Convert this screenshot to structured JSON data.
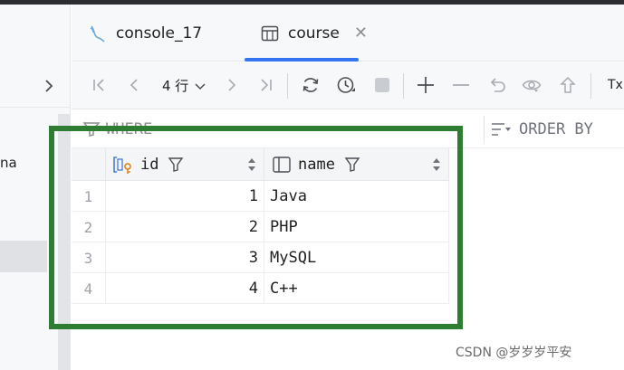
{
  "tabs": [
    {
      "label": "console_17",
      "icon": "console-icon",
      "active": false
    },
    {
      "label": "course",
      "icon": "table-icon",
      "active": true,
      "close_icon": "close-icon"
    }
  ],
  "left_panel": {
    "partial_text": "na"
  },
  "toolbar": {
    "rows_label": "4 行",
    "tx_label": "Tx",
    "icons": [
      "first-page-icon",
      "prev-page-icon",
      "rows-dropdown-icon",
      "next-page-icon",
      "last-page-icon",
      "refresh-icon",
      "history-icon",
      "stop-icon",
      "add-row-icon",
      "delete-row-icon",
      "revert-icon",
      "preview-icon",
      "submit-icon"
    ]
  },
  "filter": {
    "where_label": "WHERE",
    "order_by_label": "ORDER BY"
  },
  "table": {
    "columns": [
      {
        "label": "id",
        "icon": "key-column-icon"
      },
      {
        "label": "name",
        "icon": "column-icon"
      }
    ],
    "rows": [
      {
        "n": "1",
        "id": "1",
        "name": "Java"
      },
      {
        "n": "2",
        "id": "2",
        "name": "PHP"
      },
      {
        "n": "3",
        "id": "3",
        "name": "MySQL"
      },
      {
        "n": "4",
        "id": "4",
        "name": "C++"
      }
    ]
  },
  "highlight_color": "#2f7d32",
  "accent_color": "#3574f0",
  "watermark": "CSDN @岁岁岁平安"
}
